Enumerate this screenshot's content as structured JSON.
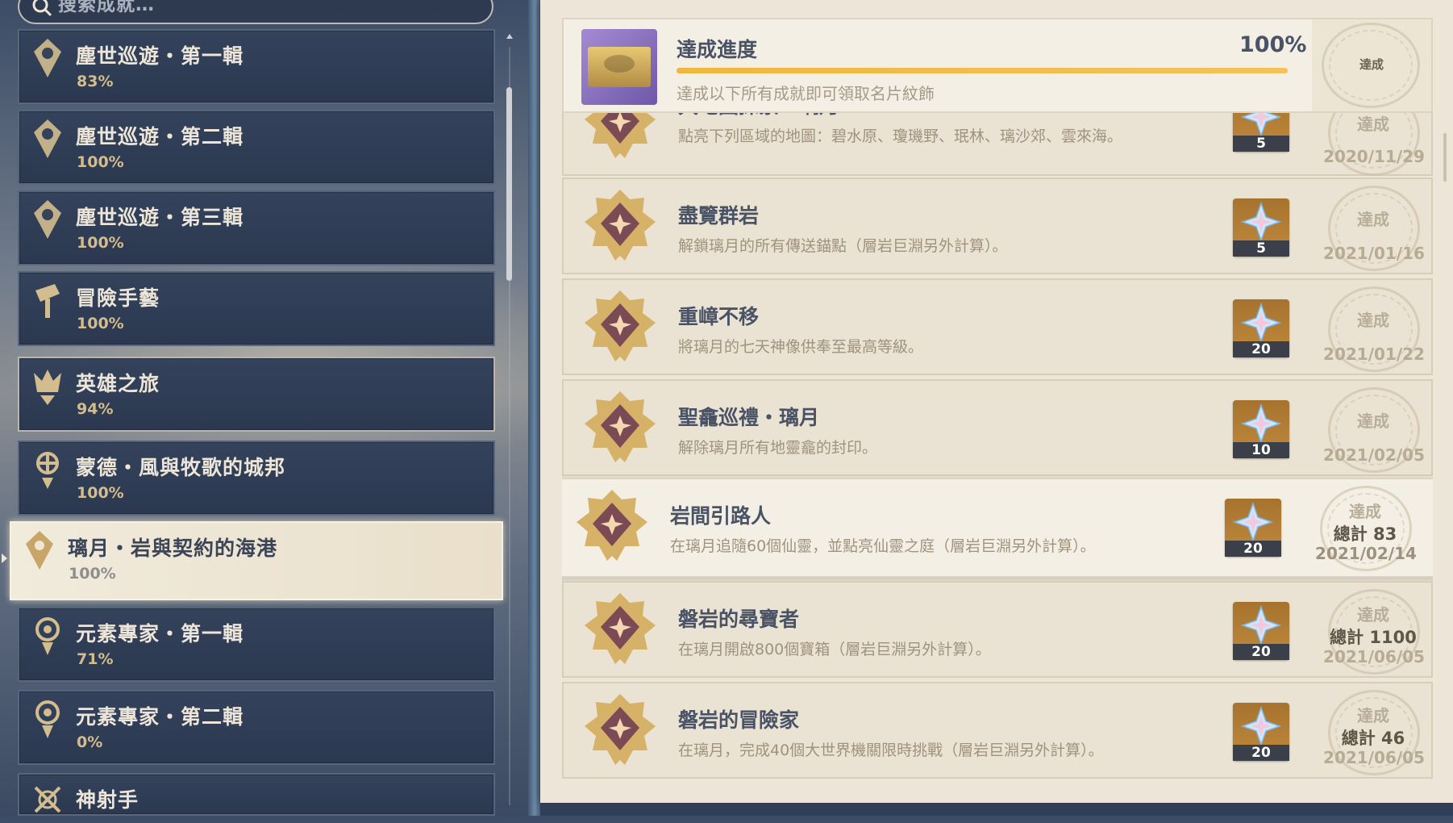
{
  "search": {
    "placeholder": "搜索成就…"
  },
  "categories": [
    {
      "title": "塵世巡遊・第一輯",
      "pct": "83%"
    },
    {
      "title": "塵世巡遊・第二輯",
      "pct": "100%"
    },
    {
      "title": "塵世巡遊・第三輯",
      "pct": "100%"
    },
    {
      "title": "冒險手藝",
      "pct": "100%"
    },
    {
      "title": "英雄之旅",
      "pct": "94%"
    },
    {
      "title": "蒙德・風與牧歌的城邦",
      "pct": "100%"
    },
    {
      "title": "璃月・岩與契約的海港",
      "pct": "100%"
    },
    {
      "title": "元素專家・第一輯",
      "pct": "71%"
    },
    {
      "title": "元素專家・第二輯",
      "pct": "0%"
    },
    {
      "title": "神射手",
      "pct": ""
    }
  ],
  "header": {
    "title": "達成進度",
    "percent": "100%",
    "progress": 1.0,
    "description": "達成以下所有成就即可領取名片紋飾",
    "stamp": "達成"
  },
  "achievements": [
    {
      "name": "大地圖探索・璃月",
      "desc": "點亮下列區域的地圖：碧水原、瓊璣野、珉林、璃沙郊、雲來海。",
      "reward": "5",
      "stamp": "達成",
      "total": "",
      "date": "2020/11/29"
    },
    {
      "name": "盡覽群岩",
      "desc": "解鎖璃月的所有傳送錨點（層岩巨淵另外計算）。",
      "reward": "5",
      "stamp": "達成",
      "total": "",
      "date": "2021/01/16"
    },
    {
      "name": "重嶂不移",
      "desc": "將璃月的七天神像供奉至最高等級。",
      "reward": "20",
      "stamp": "達成",
      "total": "",
      "date": "2021/01/22"
    },
    {
      "name": "聖龕巡禮・璃月",
      "desc": "解除璃月所有地靈龕的封印。",
      "reward": "10",
      "stamp": "達成",
      "total": "",
      "date": "2021/02/05"
    },
    {
      "name": "岩間引路人",
      "desc": "在璃月追隨60個仙靈，並點亮仙靈之庭（層岩巨淵另外計算）。",
      "reward": "20",
      "stamp": "達成",
      "total": "總計 83",
      "date": "2021/02/14"
    },
    {
      "name": "磐岩的尋寶者",
      "desc": "在璃月開啟800個寶箱（層岩巨淵另外計算）。",
      "reward": "20",
      "stamp": "達成",
      "total": "總計 1100",
      "date": "2021/06/05"
    },
    {
      "name": "磐岩的冒險家",
      "desc": "在璃月，完成40個大世界機關限時挑戰（層岩巨淵另外計算）。",
      "reward": "20",
      "stamp": "達成",
      "total": "總計 46",
      "date": "2021/06/05"
    }
  ],
  "colors": {
    "accent": "#f0b73e",
    "panel": "#ece5d8",
    "dark_item": "#2e3b53",
    "title_text": "#4a5366"
  }
}
